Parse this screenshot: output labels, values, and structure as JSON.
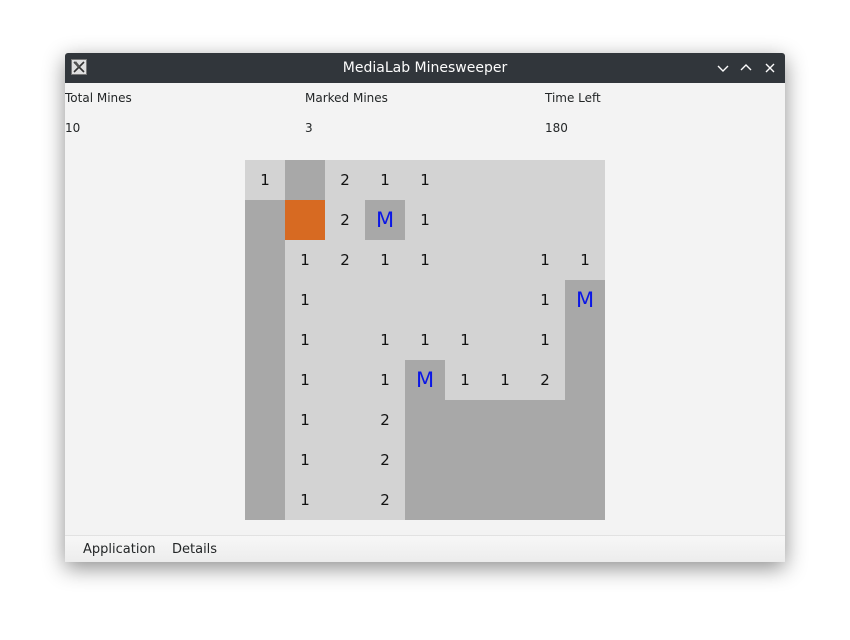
{
  "window": {
    "title": "MediaLab Minesweeper",
    "icon": "x11-app-icon",
    "controls": [
      "minimize-icon",
      "maximize-icon",
      "close-icon"
    ]
  },
  "stats": {
    "total_mines_label": "Total Mines",
    "total_mines_value": "10",
    "marked_mines_label": "Marked Mines",
    "marked_mines_value": "3",
    "time_left_label": "Time Left",
    "time_left_value": "180"
  },
  "board": {
    "rows": 9,
    "cols": 9,
    "flag_text": "M",
    "colors": {
      "hidden": "#a8a8a8",
      "revealed": "#d3d3d3",
      "exploded": "#d76a22",
      "flag": "#0a16e6"
    },
    "cells": [
      [
        "1",
        "#",
        "2",
        "1",
        "1",
        "",
        "",
        "",
        ""
      ],
      [
        "#",
        "X",
        "2",
        "M",
        "1",
        "",
        "",
        "",
        ""
      ],
      [
        "#",
        "1",
        "2",
        "1",
        "1",
        "",
        "",
        "1",
        "1"
      ],
      [
        "#",
        "1",
        "",
        "",
        "",
        "",
        "",
        "1",
        "M"
      ],
      [
        "#",
        "1",
        "",
        "1",
        "1",
        "1",
        "",
        "1",
        "#"
      ],
      [
        "#",
        "1",
        "",
        "1",
        "M",
        "1",
        "1",
        "2",
        "#"
      ],
      [
        "#",
        "1",
        "",
        "2",
        "#",
        "#",
        "#",
        "#",
        "#"
      ],
      [
        "#",
        "1",
        "",
        "2",
        "#",
        "#",
        "#",
        "#",
        "#"
      ],
      [
        "#",
        "1",
        "",
        "2",
        "#",
        "#",
        "#",
        "#",
        "#"
      ]
    ]
  },
  "menu": {
    "application": "Application",
    "details": "Details"
  }
}
